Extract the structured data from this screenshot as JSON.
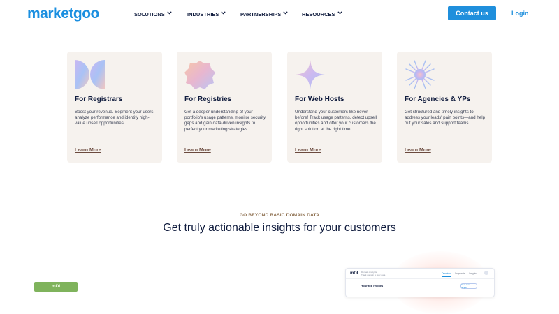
{
  "header": {
    "logo": "marketgoo",
    "nav": [
      "SOLUTIONS",
      "INDUSTRIES",
      "PARTNERSHIPS",
      "RESOURCES"
    ],
    "contact_label": "Contact us",
    "login_label": "Login"
  },
  "cards": [
    {
      "title": "For Registrars",
      "icon": "half-circles-icon",
      "desc": "Boost your revenue. Segment your users, analyze performance and identify high-value upsell opportunities.",
      "link": "Learn More"
    },
    {
      "title": "For Registries",
      "icon": "octagon-badge-icon",
      "desc": "Get a deeper understanding of your portfolio's usage patterns, monitor security gaps and gain data-driven insights to perfect your marketing strategies.",
      "link": "Learn More"
    },
    {
      "title": "For Web Hosts",
      "icon": "sparkle-star-icon",
      "desc": "Understand your customers like never before! Track usage patterns, detect upsell opportunities and offer your customers the right solution at the right time.",
      "link": "Learn More"
    },
    {
      "title": "For Agencies & YPs",
      "icon": "starburst-icon",
      "desc": "Get structured and timely insights to address your leads' pain points—and help out your sales and support teams.",
      "link": "Learn More"
    }
  ],
  "section": {
    "eyebrow": "GO BEYOND BASIC DOMAIN DATA",
    "headline": "Get truly actionable insights for your customers"
  },
  "bottom": {
    "green_tab_label": "mDI",
    "preview": {
      "brand": "mDI",
      "sub_line1": "Domain Analysis",
      "sub_line2": "Track domain & user data",
      "tabs": [
        "Overview",
        "Segments",
        "Insights"
      ],
      "section_title": "Your top recipes",
      "pill_label": "View more recipes"
    }
  }
}
